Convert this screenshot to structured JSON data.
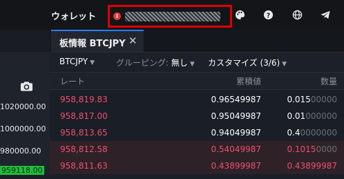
{
  "topbar": {
    "wallet_label": "ウォレット",
    "masked_account": ""
  },
  "left_panel": {
    "values": [
      "1020000.00",
      "1000000.00",
      "980000.00",
      "959118.00"
    ]
  },
  "tab": {
    "title": "板情報 BTCJPY",
    "close": "✕"
  },
  "controls": {
    "pair": "BTCJPY",
    "grouping_label": "グルーピング:",
    "grouping_value": "無し",
    "customize": "カスタマイズ (3/6)"
  },
  "columns": {
    "rate": "レート",
    "cumulative": "累積値",
    "quantity": "数量"
  },
  "rows": [
    {
      "price": "958,819.83",
      "cum": "0.96549987",
      "qty_bright": "0.015",
      "qty_dim": "00000"
    },
    {
      "price": "958,817.00",
      "cum": "0.95049987",
      "qty_bright": "0.01",
      "qty_dim": "000000"
    },
    {
      "price": "958,813.65",
      "cum": "0.94049987",
      "qty_bright": "0.4",
      "qty_dim": "0000000"
    },
    {
      "price": "958,812.58",
      "cum": "0.54049987",
      "qty_bright": "0.1015",
      "qty_dim": "0000"
    },
    {
      "price": "958,811.63",
      "cum": "0.43899987",
      "qty_bright": "0.43899987",
      "qty_dim": ""
    }
  ],
  "colors": {
    "accent": "#2d7ff9",
    "sell_red": "#f0506e",
    "highlight_box": "#e00000"
  }
}
